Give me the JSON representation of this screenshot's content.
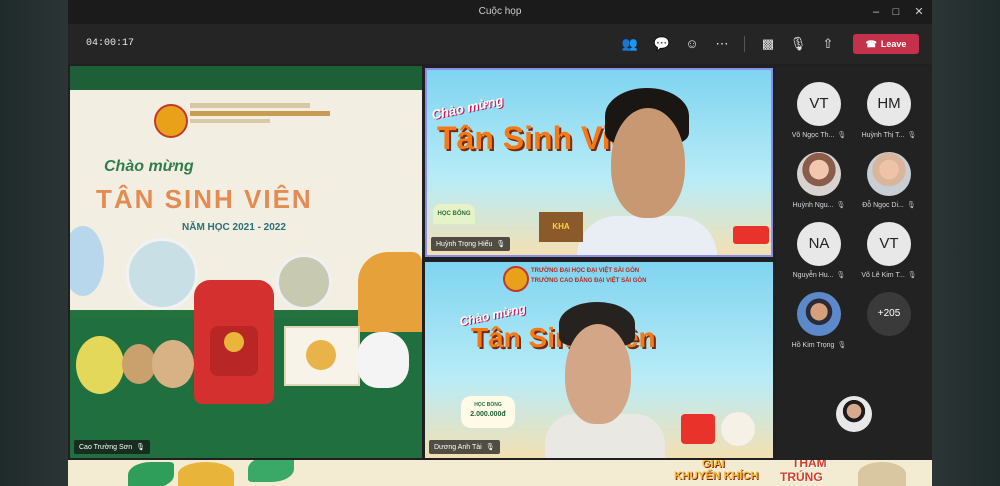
{
  "window": {
    "title": "Cuộc họp"
  },
  "toolbar": {
    "timer": "04:00:17",
    "leave_label": "Leave"
  },
  "icons": {
    "people": "people-icon",
    "chat": "chat-icon",
    "reactions": "reactions-icon",
    "more": "more-icon",
    "camera": "camera-off-icon",
    "mic": "mic-off-icon",
    "share": "share-icon",
    "phone": "phone-icon"
  },
  "colors": {
    "leave": "#c4314b",
    "active_border": "#8a8fe8"
  },
  "stage": {
    "main": {
      "name": "Cao Trường Sơn",
      "banner_line1": "Chào mừng",
      "banner_line2": "TÂN SINH VIÊN",
      "banner_line3": "NĂM HỌC 2021 - 2022"
    },
    "top_right": {
      "name": "Huỳnh Trọng Hiếu",
      "line1": "Chào mừng",
      "line2": "Tân Sinh Viên",
      "tag1": "HỌC BỔNG",
      "tag2": "KHA"
    },
    "bottom_right": {
      "name": "Dương Anh Tài",
      "school1": "TRƯỜNG ĐẠI HỌC ĐẠI VIỆT SÀI GÒN",
      "school2": "TRƯỜNG CAO ĐẲNG ĐẠI VIỆT SÀI GÒN",
      "line1": "Chào mừng",
      "line2": "Tân Sinh Viên",
      "scholarship_label": "HỌC BỔNG",
      "scholarship_amount": "2.000.000đ"
    }
  },
  "participants": [
    {
      "initials": "VT",
      "name": "Võ Ngọc Th..."
    },
    {
      "initials": "HM",
      "name": "Huỳnh Thị T..."
    },
    {
      "initials": "",
      "name": "Huỳnh Ngu..."
    },
    {
      "initials": "",
      "name": "Đỗ Ngọc Di..."
    },
    {
      "initials": "NA",
      "name": "Nguyễn Hu..."
    },
    {
      "initials": "VT",
      "name": "Võ Lê Kim T..."
    },
    {
      "initials": "",
      "name": "Hồ Kim Trọng"
    },
    {
      "initials": "+205",
      "name": ""
    }
  ],
  "bottom_strip": {
    "text1": "GIẢI",
    "text2": "KHUYẾN KHÍCH",
    "text3": "THAM",
    "text4": "TRÚNG"
  }
}
